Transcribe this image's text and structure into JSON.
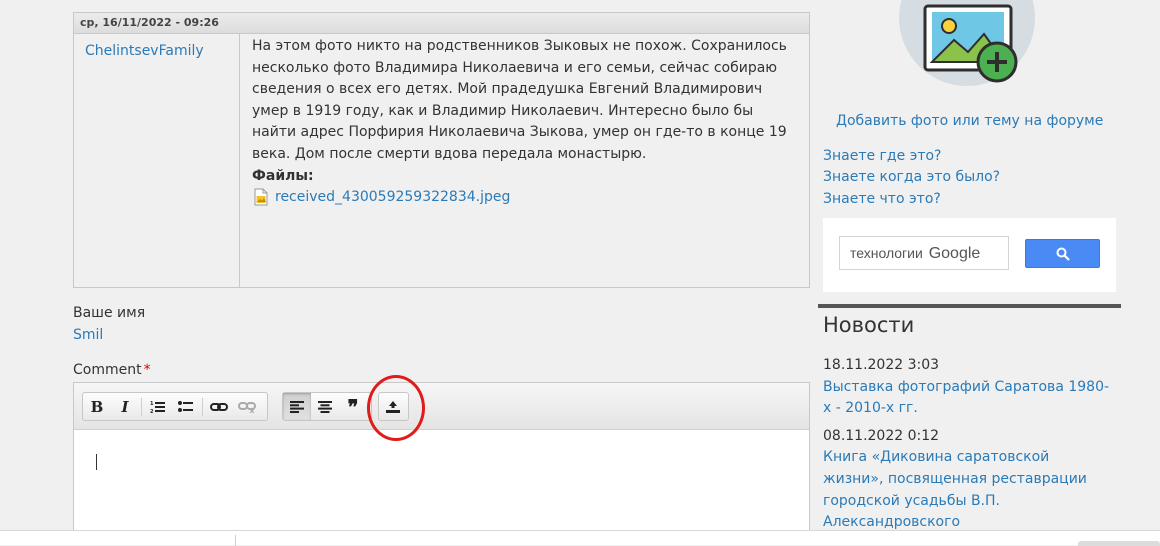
{
  "comment": {
    "header_date": "ср, 16/11/2022 - 09:26",
    "author": "ChelintsevFamily",
    "lines": [
      "На этом фото никто на родственников Зыковых не похож. Сохранилось",
      "несколько фото Владимира Николаевича и его семьи, сейчас собираю",
      "сведения о всех его детях. Мой прадедушка Евгений Владимирович",
      "умер в 1919 году, как и Владимир Николаевич. Интересно было бы",
      "найти адрес Порфирия Николаевича Зыкова, умер он где-то в конце 19",
      "века. Дом после смерти вдова передала монастырю."
    ],
    "files_label": "Файлы:",
    "file_name": "received_430059259322834.jpeg",
    "file_icon": "image-file-icon"
  },
  "form": {
    "name_label": "Ваше имя",
    "name_value": "Smil",
    "comment_label": "Comment",
    "required_mark": "*",
    "toolbar": {
      "bold": "B",
      "italic": "I",
      "quote": "❞",
      "icons": [
        "bold-icon",
        "italic-icon",
        "numbered-list-icon",
        "bulleted-list-icon",
        "link-icon",
        "unlink-icon",
        "align-left-icon",
        "align-center-icon",
        "blockquote-icon",
        "upload-icon"
      ],
      "active": "align-left",
      "highlight_color": "#e11a1a"
    }
  },
  "sidebar": {
    "add_photo_link": "Добавить фото или тему на форуме",
    "add_photo_icon": "add-image-icon",
    "question_links": [
      "Знаете где это?",
      "Знаете когда это было?",
      "Знаете что это?"
    ],
    "search": {
      "prefix": "технологии",
      "brand": "Google",
      "button_icon": "search-icon",
      "button_color": "#4a8af4"
    },
    "news_title": "Новости",
    "news": [
      {
        "date": "18.11.2022 3:03",
        "lines": [
          "Выставка фотографий Саратова 1980-",
          "х - 2010-х гг."
        ]
      },
      {
        "date": "08.11.2022 0:12",
        "lines": [
          "Книга «Диковина саратовской",
          "жизни», посвященная реставрации",
          "городской усадьбы В.П.",
          "Александровского"
        ]
      }
    ]
  }
}
